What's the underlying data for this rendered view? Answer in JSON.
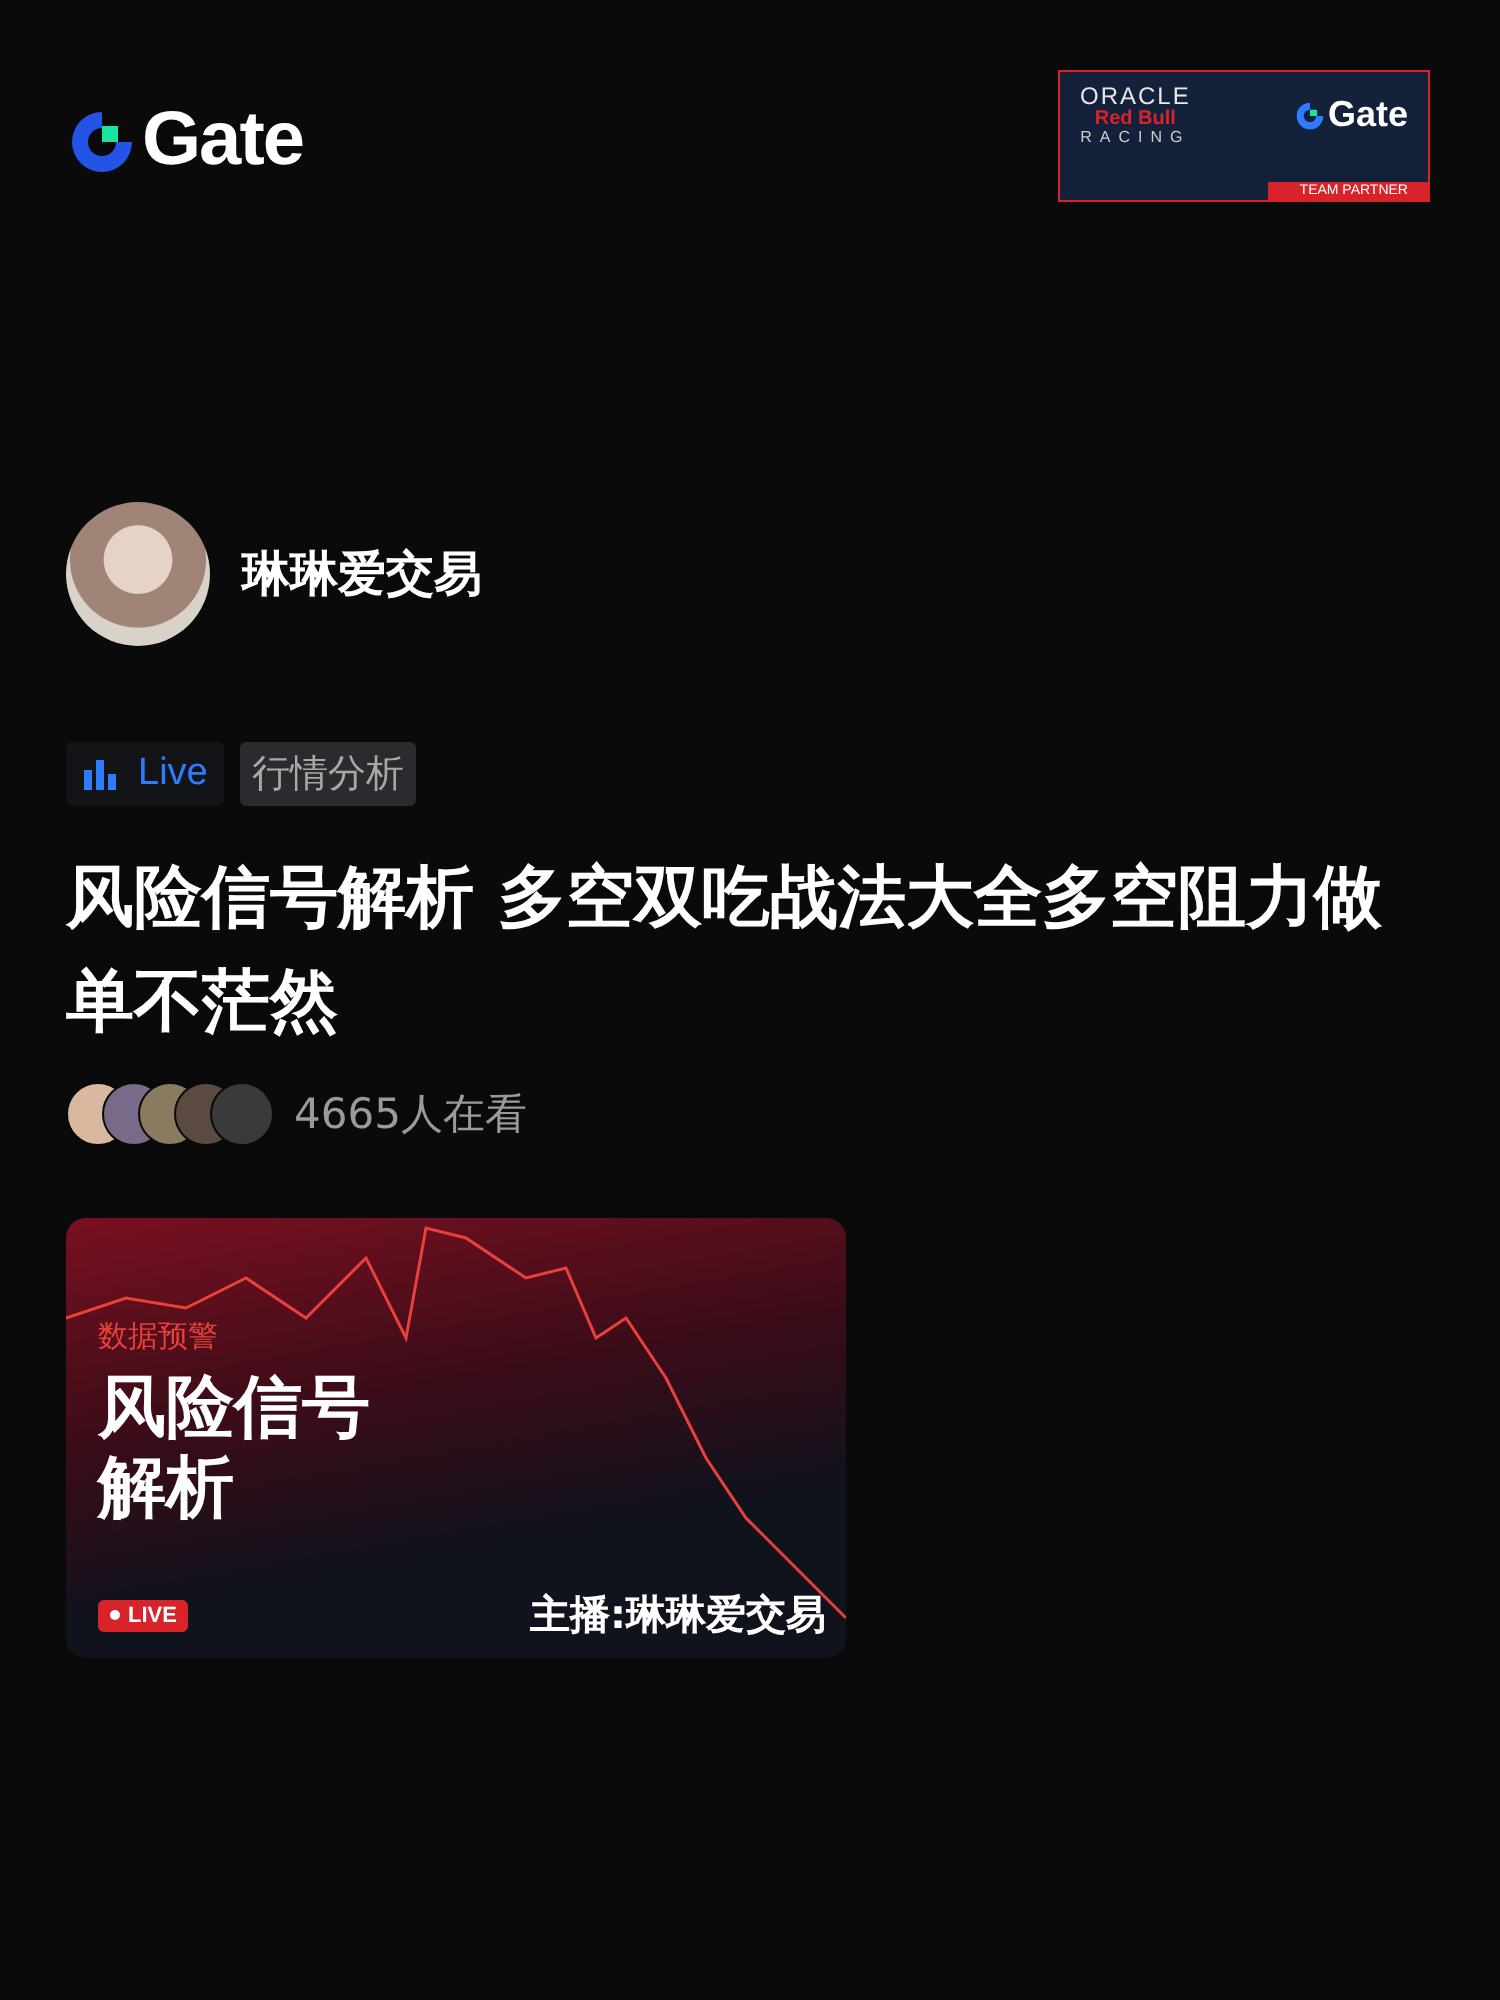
{
  "header": {
    "logo": "Gate",
    "partner_badge": {
      "lines": [
        "ORACLE",
        "Red Bull",
        "RACING"
      ],
      "brand": "Gate",
      "caption": "TEAM PARTNER"
    }
  },
  "author": {
    "name": "琳琳爱交易"
  },
  "tags": [
    {
      "kind": "live",
      "label": "Live"
    },
    {
      "kind": "category",
      "label": "行情分析"
    }
  ],
  "title": "风险信号解析 多空双吃战法大全多空阻力做单不茫然",
  "viewers": {
    "count": "4665人在看"
  },
  "cover": {
    "kicker": "数据预警",
    "headline": [
      "风险信号",
      "解析"
    ],
    "live_badge": "LIVE",
    "host": "主播:琳琳爱交易"
  }
}
